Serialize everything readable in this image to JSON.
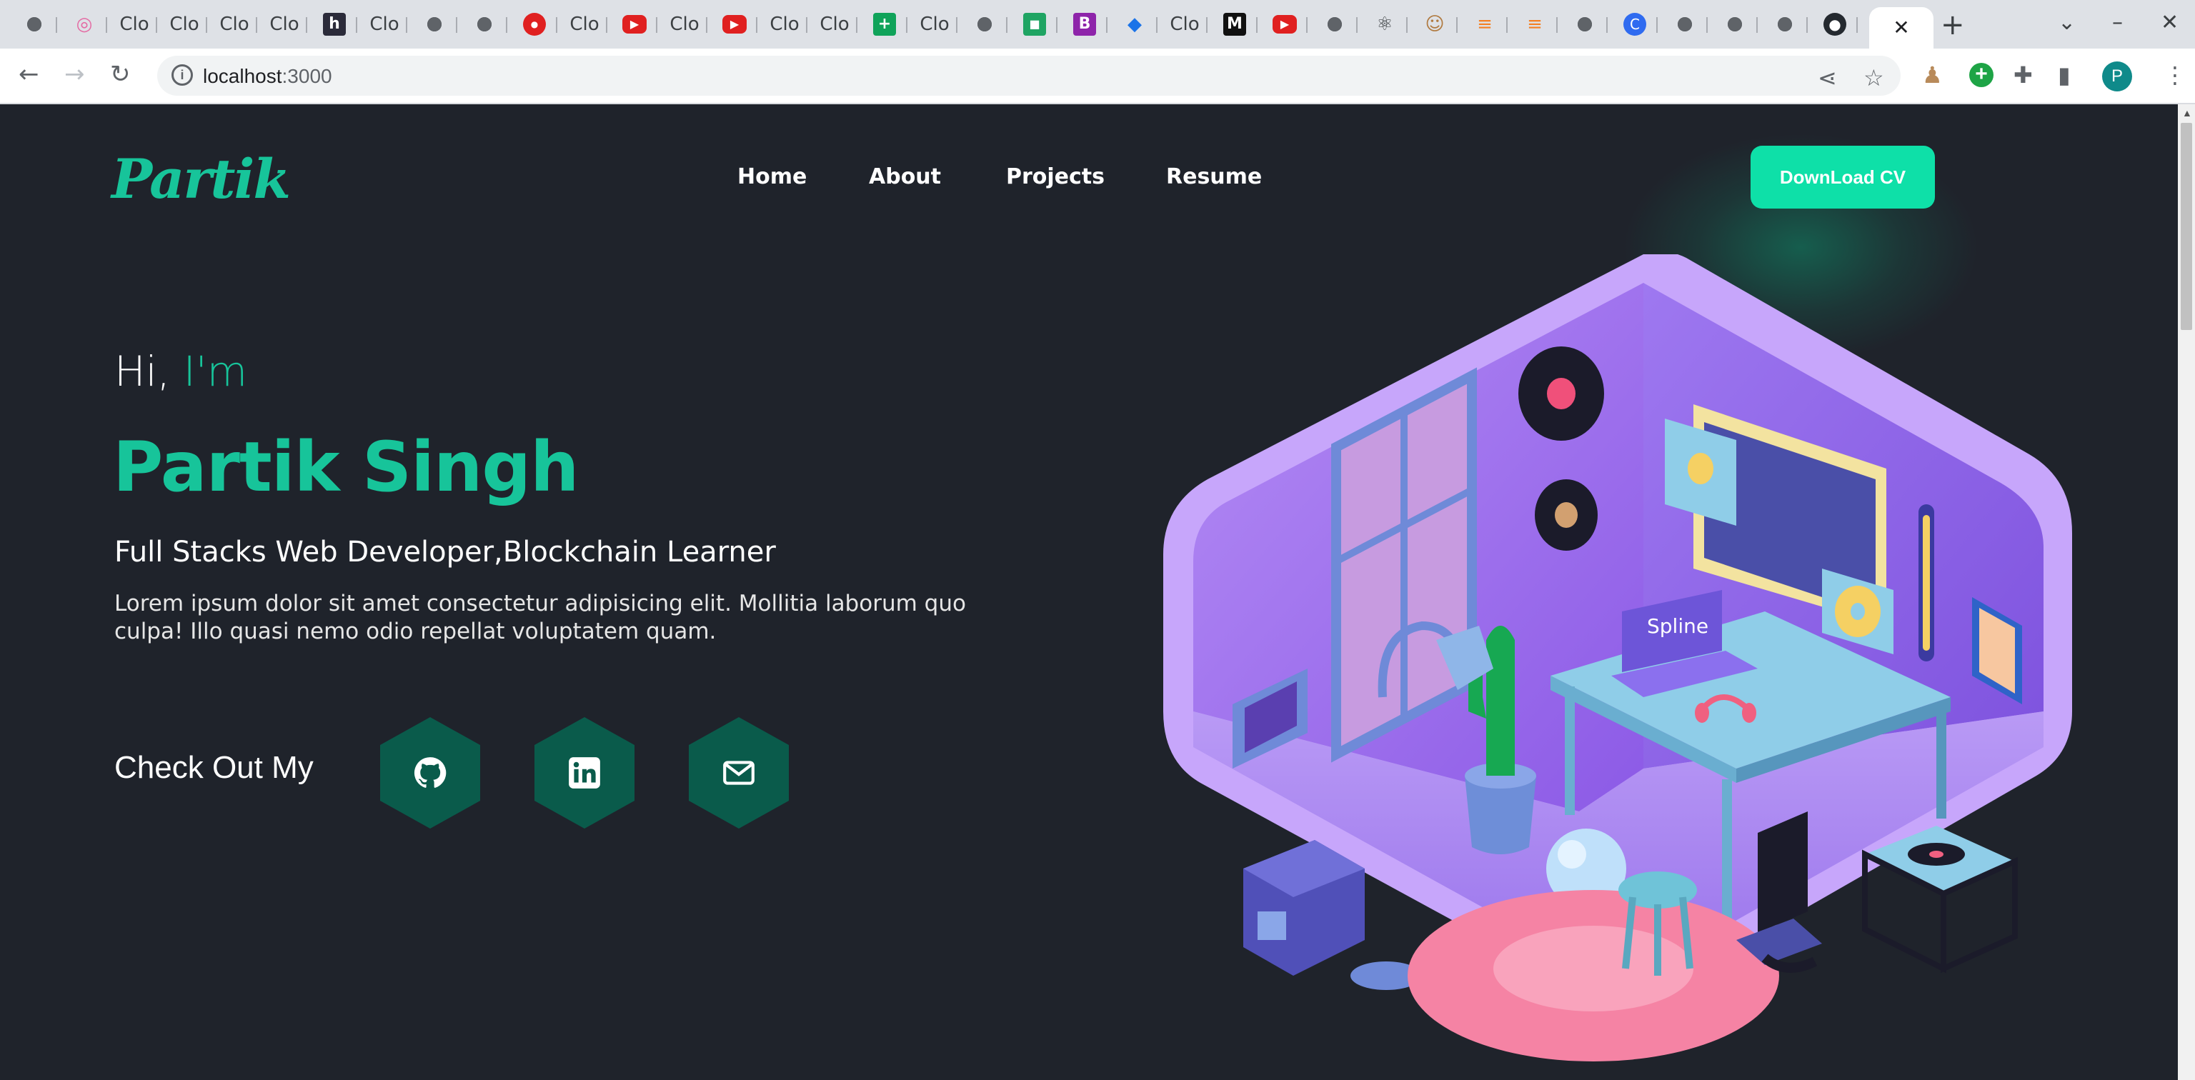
{
  "browser": {
    "tab_label": "Clo",
    "url_host": "localhost",
    "url_port": ":3000",
    "profile_initial": "P",
    "close_tab_glyph": "✕",
    "new_tab_glyph": "+",
    "back_glyph": "←",
    "forward_glyph": "→",
    "reload_glyph": "↻"
  },
  "site": {
    "logo": "Partik",
    "nav": [
      "Home",
      "About",
      "Projects",
      "Resume"
    ],
    "cta_label": "DownLoad CV",
    "greeting_prefix": "Hi,",
    "greeting_accent": "I'm",
    "name": "Partik Singh",
    "role": "Full Stacks Web Developer,Blockchain Learner",
    "description": "Lorem ipsum dolor sit amet consectetur adipisicing elit. Mollitia laborum quo culpa! Illo quasi nemo odio repellat voluptatem quam.",
    "checkout_label": "Check Out My",
    "socials": [
      "github-icon",
      "linkedin-icon",
      "mail-icon"
    ],
    "hero_screen_label": "Spline"
  },
  "colors": {
    "background": "#1f232b",
    "accent": "#17c49a",
    "cta": "#0ee0a8",
    "hex": "#0a5b4b"
  }
}
